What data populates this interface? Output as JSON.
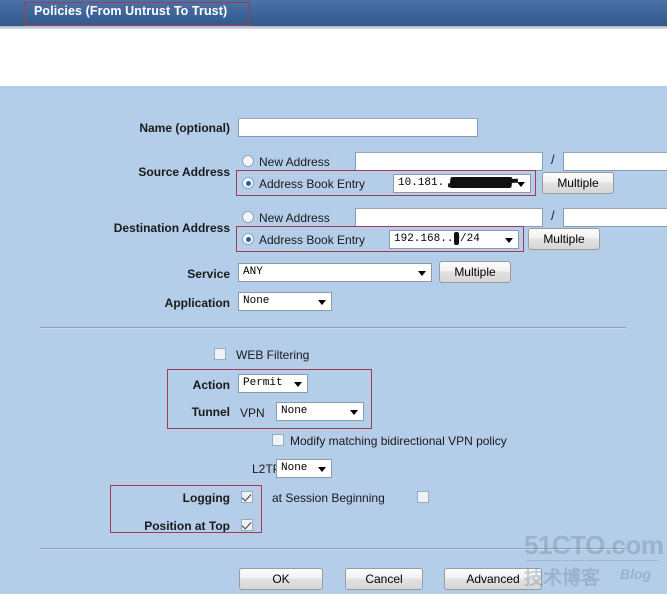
{
  "window": {
    "title": "Policies (From Untrust To Trust)"
  },
  "form": {
    "name_label": "Name (optional)",
    "name_value": "",
    "source_label": "Source Address",
    "destination_label": "Destination Address",
    "new_address_label": "New Address",
    "address_book_entry_label": "Address Book Entry",
    "source_new_address_value": "",
    "source_new_netmask_value": "",
    "source_book_entry_value": "10.181.",
    "destination_new_address_value": "",
    "destination_new_netmask_value": "",
    "destination_book_entry_value": "192.168.",
    "destination_book_entry_suffix": ".0/24",
    "slash": "/",
    "multiple_label": "Multiple",
    "service_label": "Service",
    "service_value": "ANY",
    "application_label": "Application",
    "application_value": "None",
    "web_filtering_label": "WEB Filtering",
    "web_filtering_checked": false,
    "action_label": "Action",
    "action_value": "Permit",
    "tunnel_label": "Tunnel",
    "vpn_label": "VPN",
    "vpn_value": "None",
    "modify_bidirectional_label": "Modify matching bidirectional VPN policy",
    "modify_bidirectional_checked": false,
    "l2tp_label": "L2TP",
    "l2tp_value": "None",
    "logging_label": "Logging",
    "logging_checked": true,
    "session_beginning_label": "at Session Beginning",
    "session_beginning_checked": false,
    "position_at_top_label": "Position at Top",
    "position_at_top_checked": true
  },
  "buttons": {
    "ok": "OK",
    "cancel": "Cancel",
    "advanced": "Advanced"
  },
  "watermark": {
    "site": "51CTO.com",
    "chinese": "技术博客",
    "blog": "Blog"
  },
  "colors": {
    "titlebar": "#3d6498",
    "panel": "#b4cde8",
    "annotation": "#a33a52",
    "radio_dot": "#2a6496"
  }
}
